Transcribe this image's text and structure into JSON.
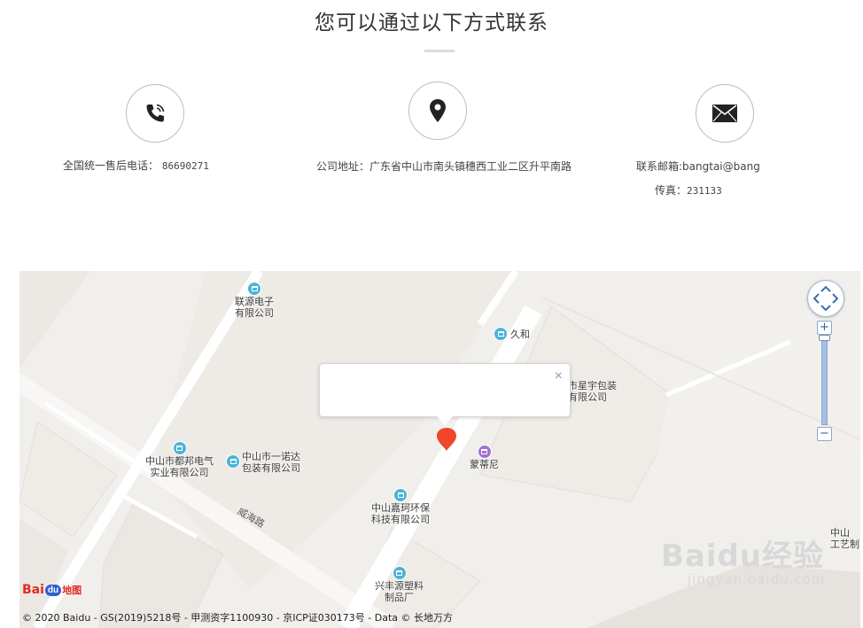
{
  "header": {
    "title": "您可以通过以下方式联系"
  },
  "contacts": [
    {
      "icon": "phone-icon",
      "label": "全国统一售后电话：",
      "value": "86690271"
    },
    {
      "icon": "location-pin-icon",
      "label": "公司地址：广东省中山市南头镇穗西工业二区升平南路",
      "value": ""
    },
    {
      "icon": "mail-icon",
      "label": "联系邮箱:bangtai@bang",
      "value": "",
      "fax_label": "传真：",
      "fax_value": "231133"
    }
  ],
  "map": {
    "pois": [
      {
        "name": "联源电子有限公司",
        "lines": [
          "联源电子",
          "有限公司"
        ]
      },
      {
        "name": "久和",
        "lines": [
          "久和"
        ]
      },
      {
        "name": "中山市星宇包装有限公司",
        "lines": [
          "市星宇包装",
          "有限公司"
        ]
      },
      {
        "name": "中山市都邦电气实业有限公司",
        "lines": [
          "中山市都邦电气",
          "实业有限公司"
        ]
      },
      {
        "name": "中山市一诺达包装有限公司",
        "lines": [
          "中山市一诺达",
          "包装有限公司"
        ]
      },
      {
        "name": "蒙蒂尼",
        "lines": [
          "蒙蒂尼"
        ]
      },
      {
        "name": "中山嘉珂环保科技有限公司",
        "lines": [
          "中山嘉珂环保",
          "科技有限公司"
        ]
      },
      {
        "name": "兴丰源塑料制品厂",
        "lines": [
          "兴丰源塑料",
          "制品厂"
        ]
      },
      {
        "name": "中山工艺制",
        "lines": [
          "中山",
          "工艺制"
        ]
      }
    ],
    "road_label": "威海路",
    "popup_close": "×",
    "zoom_in": "+",
    "zoom_out": "−",
    "logo": {
      "part1": "Bai",
      "part2": "du",
      "part3": "地图"
    },
    "copyright": "© 2020 Baidu - GS(2019)5218号 - 甲测资字1100930 - 京ICP证030173号 - Data © 长地万方",
    "watermark": {
      "brand": "Baidu经验",
      "url": "jingyan.baidu.com"
    }
  },
  "colors": {
    "marker": "#f0462b",
    "poi_blue": "#4cb4d6",
    "poi_purple": "#a26fd3"
  }
}
